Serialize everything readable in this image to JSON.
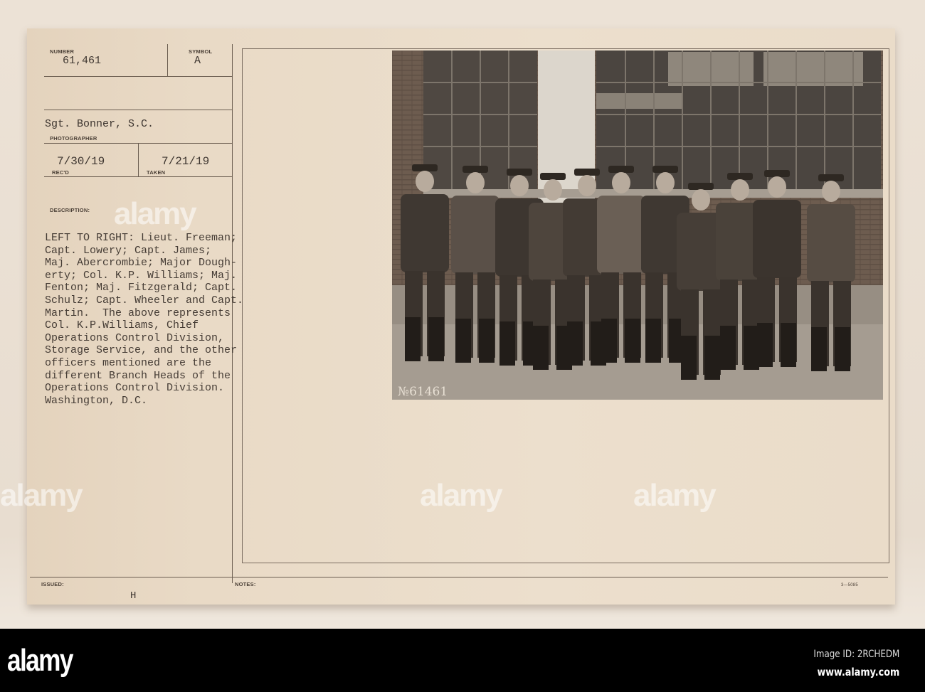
{
  "card": {
    "number_label": "NUMBER",
    "number": "61,461",
    "symbol_label": "SYMBOL",
    "symbol": "A",
    "photographer": "Sgt. Bonner, S.C.",
    "photographer_label": "PHOTOGRAPHER",
    "received": "7/30/19",
    "received_label": "REC'D",
    "taken": "7/21/19",
    "taken_label": "TAKEN",
    "description_label": "DESCRIPTION:",
    "description_lines": [
      "LEFT TO RIGHT: Lieut. Freeman;",
      "Capt. Lowery; Capt. James;",
      "Maj. Abercrombie; Major Dough-",
      "erty; Col. K.P. Williams; Maj.",
      "Fenton; Maj. Fitzgerald; Capt.",
      "Schulz; Capt. Wheeler and Capt.",
      "Martin.  The above represents",
      "Col. K.P.Williams, Chief",
      "Operations Control Division,",
      "Storage Service, and the other",
      "officers mentioned are the",
      "different Branch Heads of the",
      "Operations Control Division.",
      "Washington, D.C."
    ],
    "issued_label": "ISSUED:",
    "issued": "H",
    "notes_label": "NOTES:",
    "form_number": "3—5085",
    "photo_inscription": "№61461"
  },
  "watermark": {
    "text": "alamy"
  },
  "footer": {
    "logo": "alamy",
    "image_id": "Image ID: 2RCHEDM",
    "website": "www.alamy.com"
  }
}
